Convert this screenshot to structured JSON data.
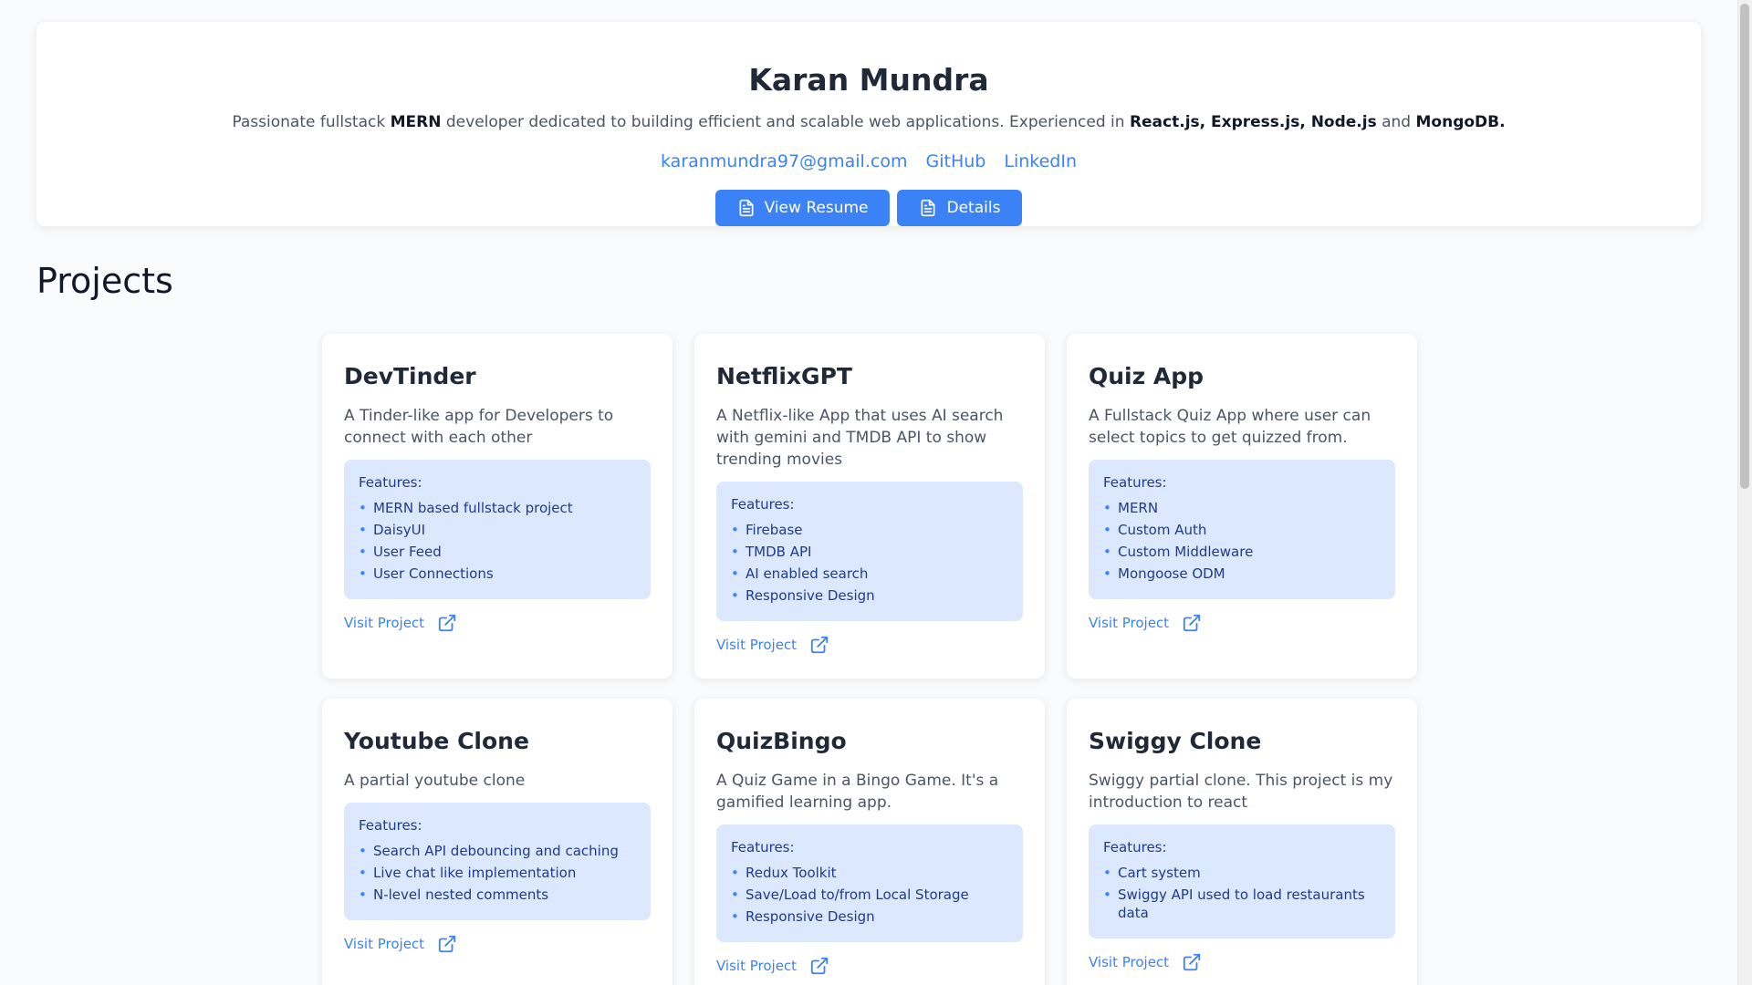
{
  "profile": {
    "name": "Karan Mundra",
    "tagline_parts": [
      "Passionate fullstack ",
      "MERN",
      " developer dedicated to building efficient and scalable web applications. Experienced in ",
      "React.js, Express.js, Node.js",
      " and ",
      "MongoDB."
    ],
    "email": "karanmundra97@gmail.com",
    "github_label": "GitHub",
    "linkedin_label": "LinkedIn",
    "view_resume_label": "View Resume",
    "details_label": "Details"
  },
  "projects_title": "Projects",
  "projects": [
    {
      "title": "DevTinder",
      "description": "A Tinder-like app for Developers to connect with each other",
      "features_label": "Features:",
      "features": [
        "MERN based fullstack project",
        "DaisyUI",
        "User Feed",
        "User Connections"
      ],
      "visit_label": "Visit Project"
    },
    {
      "title": "NetflixGPT",
      "description": "A Netflix-like App that uses AI search with gemini and TMDB API to show trending movies",
      "features_label": "Features:",
      "features": [
        "Firebase",
        "TMDB API",
        "AI enabled search",
        "Responsive Design"
      ],
      "visit_label": "Visit Project"
    },
    {
      "title": "Quiz App",
      "description": "A Fullstack Quiz App where user can select topics to get quizzed from.",
      "features_label": "Features:",
      "features": [
        "MERN",
        "Custom Auth",
        "Custom Middleware",
        "Mongoose ODM"
      ],
      "visit_label": "Visit Project"
    },
    {
      "title": "Youtube Clone",
      "description": "A partial youtube clone",
      "features_label": "Features:",
      "features": [
        "Search API debouncing and caching",
        "Live chat like implementation",
        "N-level nested comments"
      ],
      "visit_label": "Visit Project"
    },
    {
      "title": "QuizBingo",
      "description": "A Quiz Game in a Bingo Game. It's a gamified learning app.",
      "features_label": "Features:",
      "features": [
        "Redux Toolkit",
        "Save/Load to/from Local Storage",
        "Responsive Design"
      ],
      "visit_label": "Visit Project"
    },
    {
      "title": "Swiggy Clone",
      "description": "Swiggy partial clone. This project is my introduction to react",
      "features_label": "Features:",
      "features": [
        "Cart system",
        "Swiggy API used to load restaurants data"
      ],
      "visit_label": "Visit Project"
    }
  ],
  "colors": {
    "accent": "#3b82f6",
    "feature_bg": "#dbe8fd",
    "feature_text": "#1e3a8a"
  }
}
